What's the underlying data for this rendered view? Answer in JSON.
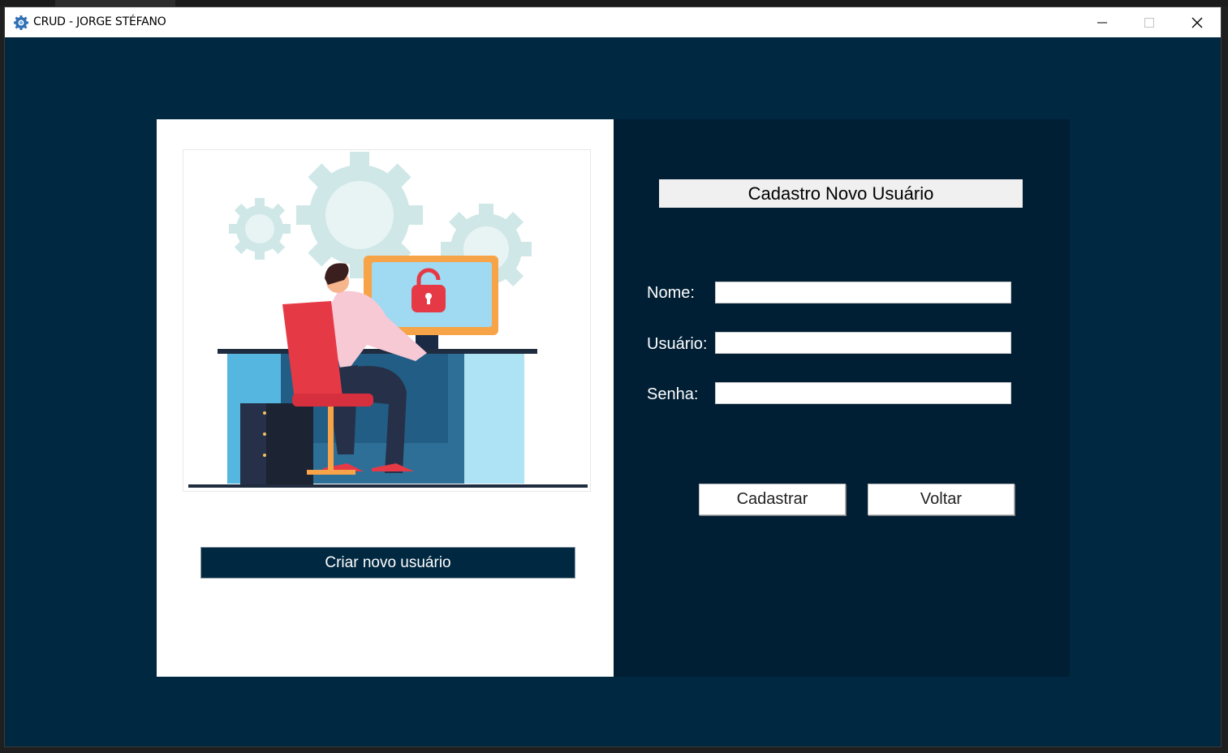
{
  "window": {
    "title": "CRUD - JORGE STÉFANO"
  },
  "left_panel": {
    "illustration_icon": "user-at-computer-with-padlock-illustration",
    "create_user_button": "Criar novo usuário"
  },
  "form": {
    "title": "Cadastro Novo Usuário",
    "fields": [
      {
        "label": "Nome:",
        "value": ""
      },
      {
        "label": "Usuário:",
        "value": ""
      },
      {
        "label": "Senha:",
        "value": ""
      }
    ],
    "buttons": {
      "submit": "Cadastrar",
      "back": "Voltar"
    }
  },
  "colors": {
    "window_bg": "#002840",
    "form_panel_bg": "#001f35",
    "illustration_accent": "#e63946"
  }
}
